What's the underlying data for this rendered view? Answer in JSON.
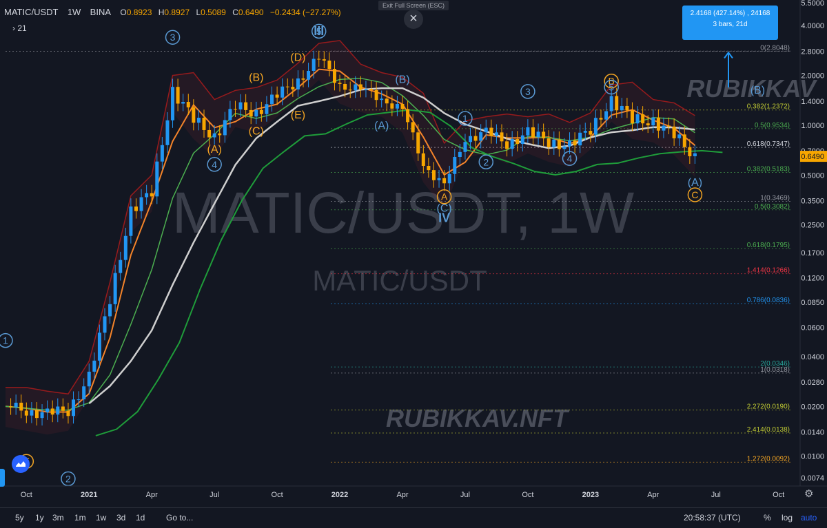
{
  "header": {
    "symbol": "MATIC/USDT",
    "interval": "1W",
    "exchange": "BINA",
    "ohlc": [
      {
        "k": "O",
        "v": "0.8923"
      },
      {
        "k": "H",
        "v": "0.8927"
      },
      {
        "k": "L",
        "v": "0.5089"
      },
      {
        "k": "C",
        "v": "0.6490"
      }
    ],
    "change": "−0.2434 (−27.27%)",
    "indicators_toggle": "› 21"
  },
  "overlay": {
    "exit_fullscreen": "Exit Full Screen (ESC)",
    "close_symbol": "×"
  },
  "measure_box": {
    "line1": "2.4168 (427.14%) , 24168",
    "line2": "3 bars, 21d"
  },
  "watermark": {
    "big": "MATIC/USDT, 1W",
    "small": "MATIC/USDT",
    "brand_top": "RUBIKKAV",
    "brand_bottom": "RUBIKKAV.NFT"
  },
  "last_price_label": "0.6490",
  "bottom_bar": {
    "ranges": [
      "5y",
      "1y",
      "3m",
      "1m",
      "1w",
      "3d",
      "1d"
    ],
    "goto": "Go to...",
    "time": "20:58:37 (UTC)",
    "percent": "%",
    "log": "log",
    "auto": "auto"
  },
  "colors": {
    "background": "#131722",
    "up_candle": "#2196f3",
    "down_candle": "#f7a600",
    "last_price": "#f7a600",
    "ema_orange": "#f5842a",
    "ma_white": "#cfcfcf",
    "kijun_green": "#1f9d3a",
    "wave_blue": "#5b9bd5",
    "wave_orange": "#f5a623"
  },
  "chart_data": {
    "type": "candlestick",
    "title": "MATIC/USDT, 1W",
    "y_scale": "log",
    "ylim": [
      0.0066,
      5.5
    ],
    "y_ticks": [
      "5.5000",
      "4.0000",
      "2.8000",
      "2.0000",
      "1.4000",
      "1.0000",
      "0.7000",
      "0.5000",
      "0.3500",
      "0.2500",
      "0.1700",
      "0.1200",
      "0.0850",
      "0.0600",
      "0.0400",
      "0.0280",
      "0.0200",
      "0.0140",
      "0.0100",
      "0.0074"
    ],
    "x_ticks": [
      "Oct",
      "2021",
      "Apr",
      "Jul",
      "Oct",
      "2022",
      "Apr",
      "Jul",
      "Oct",
      "2023",
      "Apr",
      "Jul",
      "Oct"
    ],
    "x_range": [
      "2020-09",
      "2023-11"
    ],
    "series_approx_close": [
      [
        "2020-09",
        0.02
      ],
      [
        "2020-10",
        0.019
      ],
      [
        "2020-11",
        0.018
      ],
      [
        "2020-12",
        0.019
      ],
      [
        "2021-01",
        0.03
      ],
      [
        "2021-02",
        0.09
      ],
      [
        "2021-03",
        0.3
      ],
      [
        "2021-04",
        0.4
      ],
      [
        "2021-05",
        1.6
      ],
      [
        "2021-06",
        1.1
      ],
      [
        "2021-07",
        0.85
      ],
      [
        "2021-08",
        1.3
      ],
      [
        "2021-09",
        1.2
      ],
      [
        "2021-10",
        1.5
      ],
      [
        "2021-11",
        1.9
      ],
      [
        "2021-12",
        2.5
      ],
      [
        "2022-01",
        1.8
      ],
      [
        "2022-02",
        1.6
      ],
      [
        "2022-03",
        1.5
      ],
      [
        "2022-04",
        1.2
      ],
      [
        "2022-05",
        0.6
      ],
      [
        "2022-06",
        0.42
      ],
      [
        "2022-07",
        0.85
      ],
      [
        "2022-08",
        0.9
      ],
      [
        "2022-09",
        0.78
      ],
      [
        "2022-10",
        0.9
      ],
      [
        "2022-11",
        0.8
      ],
      [
        "2022-12",
        0.75
      ],
      [
        "2023-01",
        0.95
      ],
      [
        "2023-02",
        1.4
      ],
      [
        "2023-03",
        1.1
      ],
      [
        "2023-04",
        1.05
      ],
      [
        "2023-05",
        0.88
      ],
      [
        "2023-06",
        0.649
      ]
    ],
    "fib_levels": [
      {
        "label": "0(2.8048)",
        "value": 2.8048,
        "color": "#9598a1"
      },
      {
        "label": "0.382(1.2372)",
        "value": 1.2372,
        "color": "#c0ca33"
      },
      {
        "label": "0.5(0.9534)",
        "value": 0.9534,
        "color": "#4caf50"
      },
      {
        "label": "0.618(0.7347)",
        "value": 0.7347,
        "color": "#d1d4dc"
      },
      {
        "label": "0.382(0.5183)",
        "value": 0.5183,
        "color": "#4caf50"
      },
      {
        "label": "1(0.3469)",
        "value": 0.3469,
        "color": "#9598a1"
      },
      {
        "label": "0.5(0.3082)",
        "value": 0.3082,
        "color": "#4caf50"
      },
      {
        "label": "0.618(0.1795)",
        "value": 0.1795,
        "color": "#4caf50"
      },
      {
        "label": "1.414(0.1266)",
        "value": 0.1266,
        "color": "#f23645"
      },
      {
        "label": "0.786(0.0836)",
        "value": 0.0836,
        "color": "#2196f3"
      },
      {
        "label": "2(0.0346)",
        "value": 0.0346,
        "color": "#26a69a"
      },
      {
        "label": "1(0.0318)",
        "value": 0.0318,
        "color": "#9598a1"
      },
      {
        "label": "2.272(0.0190)",
        "value": 0.019,
        "color": "#c0ca33"
      },
      {
        "label": "2.414(0.0138)",
        "value": 0.0138,
        "color": "#c0ca33"
      },
      {
        "label": "1.272(0.0092)",
        "value": 0.0092,
        "color": "#f5a623"
      }
    ],
    "wave_labels": [
      {
        "t": "1",
        "style": "circle-blue",
        "date": "2020-09",
        "value": 0.05
      },
      {
        "t": "2",
        "style": "circle-blue",
        "date": "2020-12",
        "value": 0.0073
      },
      {
        "t": "3",
        "style": "circle-blue",
        "date": "2021-05",
        "value": 3.4
      },
      {
        "t": "4",
        "style": "circle-blue",
        "date": "2021-07",
        "value": 0.58
      },
      {
        "t": "5",
        "style": "circle-blue",
        "date": "2021-12",
        "value": 3.7
      },
      {
        "t": "III",
        "style": "roman-blue",
        "date": "2021-12",
        "value": 3.5
      },
      {
        "t": "(A)",
        "style": "orange",
        "date": "2021-07",
        "value": 0.68
      },
      {
        "t": "(B)",
        "style": "orange",
        "date": "2021-09",
        "value": 1.85
      },
      {
        "t": "(C)",
        "style": "orange",
        "date": "2021-09",
        "value": 0.88
      },
      {
        "t": "(D)",
        "style": "orange",
        "date": "2021-11",
        "value": 2.45
      },
      {
        "t": "(E)",
        "style": "orange",
        "date": "2021-11",
        "value": 1.1
      },
      {
        "t": "E",
        "style": "circle-orange",
        "date": "2020-10",
        "value": 0.0093
      },
      {
        "t": "(B)",
        "style": "blue",
        "date": "2022-04",
        "value": 1.8
      },
      {
        "t": "(A)",
        "style": "blue",
        "date": "2022-03",
        "value": 0.95
      },
      {
        "t": "A",
        "style": "circle-orange",
        "date": "2022-06",
        "value": 0.37
      },
      {
        "t": "(C)",
        "style": "blue",
        "date": "2022-06",
        "value": 0.3
      },
      {
        "t": "IV",
        "style": "roman-blue",
        "date": "2022-06",
        "value": 0.26
      },
      {
        "t": "1",
        "style": "circle-blue",
        "date": "2022-07",
        "value": 1.1
      },
      {
        "t": "2",
        "style": "circle-blue",
        "date": "2022-08",
        "value": 0.6
      },
      {
        "t": "3",
        "style": "circle-blue",
        "date": "2022-10",
        "value": 1.6
      },
      {
        "t": "4",
        "style": "circle-blue",
        "date": "2022-12",
        "value": 0.63
      },
      {
        "t": "B",
        "style": "circle-orange",
        "date": "2023-02",
        "value": 1.85
      },
      {
        "t": "5",
        "style": "circle-blue",
        "date": "2023-02",
        "value": 1.7
      },
      {
        "t": "(B)",
        "style": "blue",
        "date": "2023-09",
        "value": 1.55
      },
      {
        "t": "(A)",
        "style": "blue",
        "date": "2023-06",
        "value": 0.43
      },
      {
        "t": "C",
        "style": "circle-orange",
        "date": "2023-06",
        "value": 0.38
      }
    ],
    "legend": "none",
    "grid": false
  }
}
